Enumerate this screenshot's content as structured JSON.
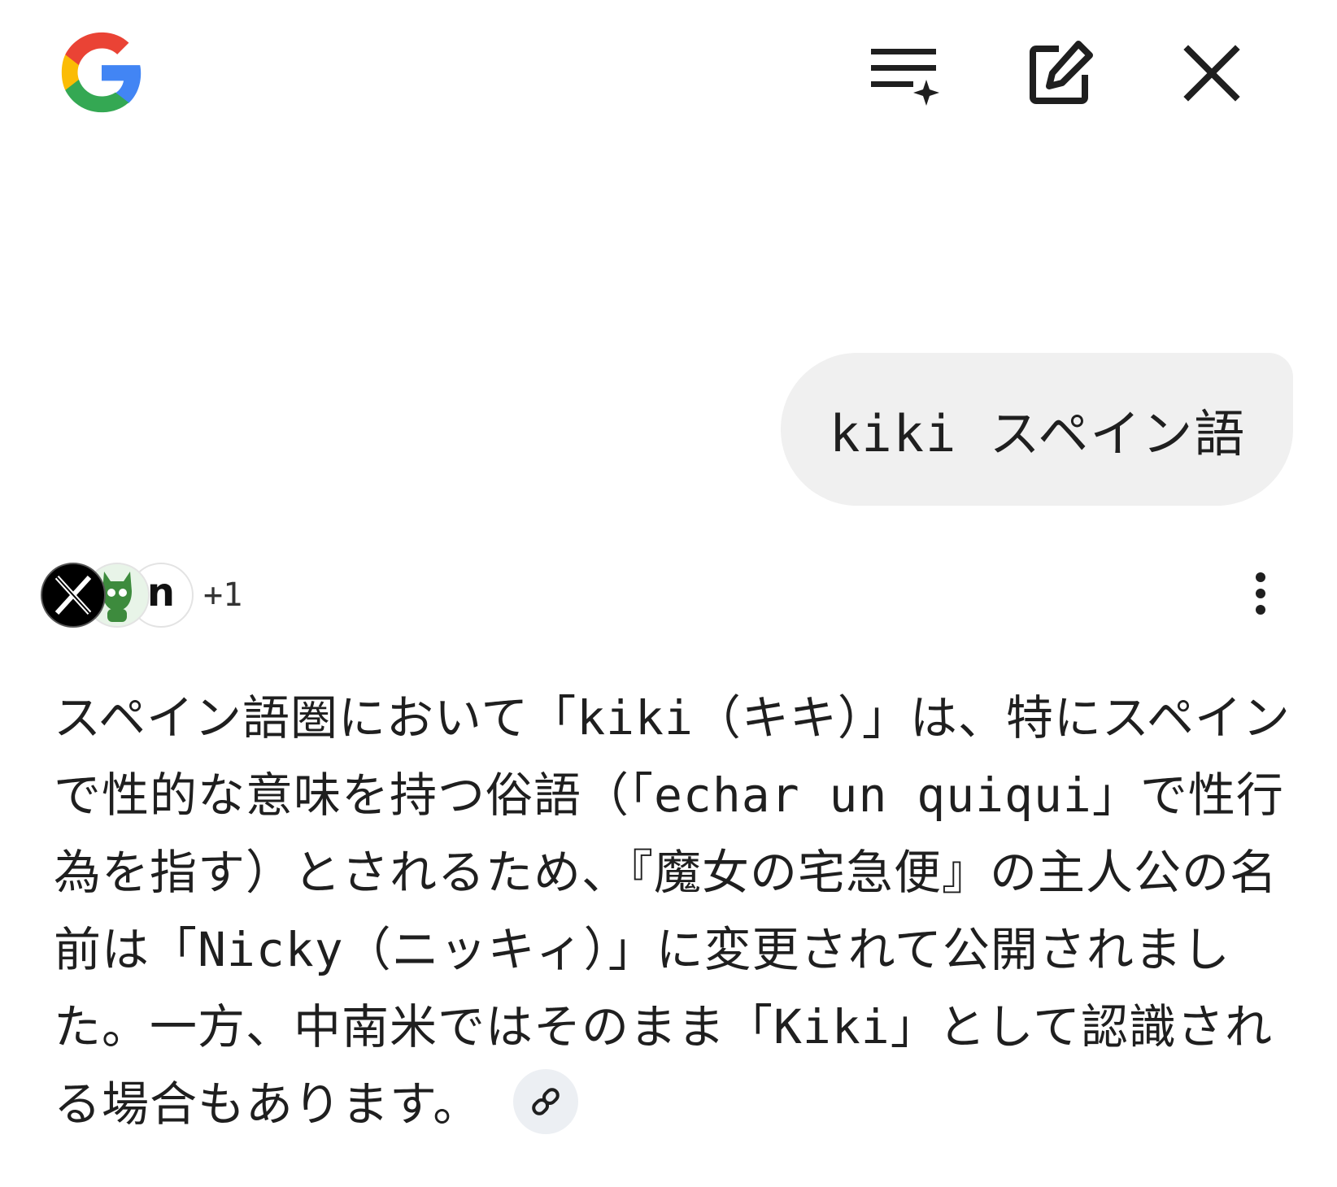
{
  "header": {
    "logo_alt": "G",
    "colors": {
      "google_blue": "#4285F4",
      "google_red": "#EA4335",
      "google_yellow": "#FBBC05",
      "google_green": "#34A853"
    }
  },
  "query": {
    "text": "kiki スペイン語"
  },
  "sources": {
    "icons": [
      "x-logo-icon",
      "green-mascot-icon",
      "n-letter-icon"
    ],
    "n_letter": "n",
    "more_count": "+1"
  },
  "answer": {
    "line1": "スペイン語圏において「",
    "kiki": "kiki",
    "line1b": "（キキ）」は、特にスペイン",
    "line2a": "で性的な意味を持つ俗語（「",
    "echar": "echar un quiqui",
    "line2b": "」で性行為を指す）とされるため、『魔女の宅急便』の主人公の名前は「",
    "nicky": "Nicky",
    "line3b": "（ニッキィ）」に変更されて公開されました。一方、中南米ではそのまま「",
    "kiki2": "Kiki",
    "line4b": "」として認識される場合もあります。"
  }
}
